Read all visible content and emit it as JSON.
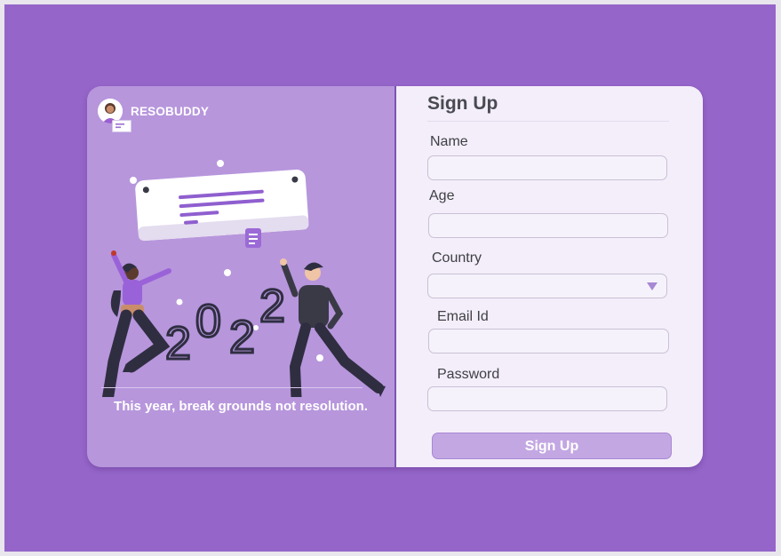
{
  "brand": {
    "name": "RESOBUDDY"
  },
  "illustration": {
    "year_text": "2022"
  },
  "tagline": "This year, break grounds not resolution.",
  "form": {
    "title": "Sign Up",
    "fields": [
      {
        "label": "Name",
        "value": "",
        "placeholder": ""
      },
      {
        "label": "Age",
        "value": "",
        "placeholder": ""
      },
      {
        "label": "Country",
        "value": "",
        "type": "select"
      },
      {
        "label": "Email Id",
        "value": "",
        "placeholder": ""
      },
      {
        "label": "Password",
        "value": "",
        "placeholder": ""
      }
    ],
    "submit_label": "Sign Up"
  },
  "colors": {
    "background": "#9565c9",
    "left_panel": "#b796dc",
    "right_panel": "#f3eef9",
    "accent": "#8f5fcf",
    "button": "#c3a7e3"
  }
}
